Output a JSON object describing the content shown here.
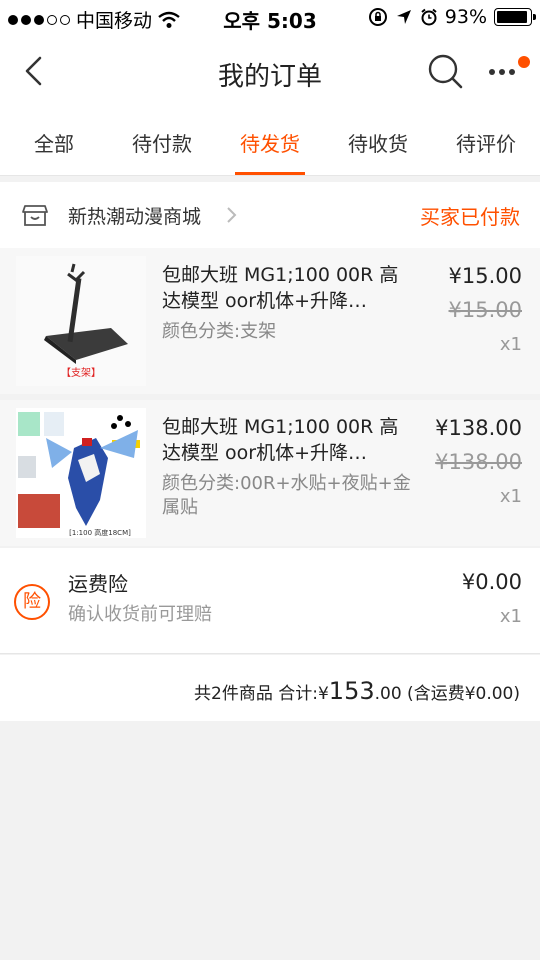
{
  "status_bar": {
    "carrier": "中国移动",
    "time": "오후 5:03",
    "battery": "93%",
    "battery_level": 0.93
  },
  "navbar": {
    "title": "我的订单",
    "icons": [
      "back-icon",
      "search-icon",
      "more-icon"
    ],
    "accent": "#ff5000"
  },
  "tabs": [
    {
      "label": "全部"
    },
    {
      "label": "待付款"
    },
    {
      "label": "待发货",
      "active": true
    },
    {
      "label": "待收货"
    },
    {
      "label": "待评价"
    }
  ],
  "order": {
    "shop_name": "新热潮动漫商城",
    "status": "买家已付款",
    "items": [
      {
        "title": "包邮大班 MG1;100 00R 高达模型 oor机体+升降…",
        "sku": "颜色分类:支架",
        "price": "¥15.00",
        "original_price": "¥15.00",
        "qty": "x1",
        "thumb_caption": "【支架】"
      },
      {
        "title": "包邮大班 MG1;100 00R 高达模型 oor机体+升降…",
        "sku": "颜色分类:00R+水贴+夜贴+金属贴",
        "price": "¥138.00",
        "original_price": "¥138.00",
        "qty": "x1",
        "thumb_caption": "[1:100 高度18CM]"
      }
    ],
    "insurance": {
      "icon_text": "险",
      "title": "运费险",
      "subtitle": "确认收货前可理赔",
      "price": "¥0.00",
      "qty": "x1"
    },
    "summary": {
      "count_text": "共2件商品 合计:",
      "currency": "¥",
      "total_int": "153",
      "total_dec": ".00",
      "shipping_text": " (含运费¥0.00)"
    }
  }
}
